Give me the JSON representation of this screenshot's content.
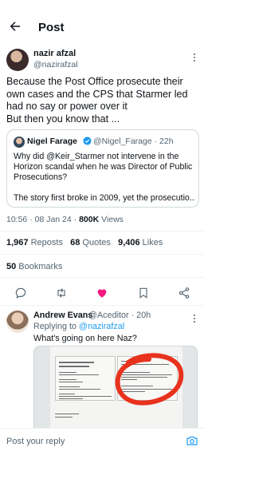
{
  "header": {
    "title": "Post"
  },
  "tweet": {
    "author_name": "nazir afzal",
    "author_handle": "@nazirafzal",
    "text_line1": "Because the Post Office prosecute their",
    "text_line2": "own cases and the CPS that Starmer led",
    "text_line3": "had no say or power over it",
    "text_line4": "But then you know that ...",
    "meta_time": "10:56 · 08 Jan 24 · ",
    "meta_views_count": "800K",
    "meta_views_label": " Views"
  },
  "quote": {
    "name": "Nigel Farage",
    "handle": "@Nigel_Farage · 22h",
    "text_line1": "Why did @Keir_Starmer not intervene in the",
    "text_line2": "Horizon scandal when he was Director of Public",
    "text_line3": "Prosecutions?",
    "text_line4": "The story first broke in 2009, yet the prosecutio..."
  },
  "stats": {
    "reposts_count": "1,967",
    "reposts_label": " Reposts",
    "quotes_count": "68",
    "quotes_label": " Quotes",
    "likes_count": "9,406",
    "likes_label": " Likes",
    "bookmarks_count": "50",
    "bookmarks_label": " Bookmarks"
  },
  "actions": [
    "reply-icon",
    "repost-icon",
    "heart-icon",
    "bookmark-icon",
    "share-icon"
  ],
  "reply": {
    "name": "Andrew Evans",
    "handle": "@Aceditor · 20h",
    "replying_prefix": "Replying to ",
    "replying_handle": "@nazirafzal",
    "text": "What's going on here Naz?"
  },
  "compose": {
    "placeholder": "Post your reply"
  },
  "colors": {
    "accent": "#1d9bf0",
    "like": "#f91880",
    "muted": "#536471",
    "text": "#0f1419",
    "annotation_red": "#e8321e"
  }
}
